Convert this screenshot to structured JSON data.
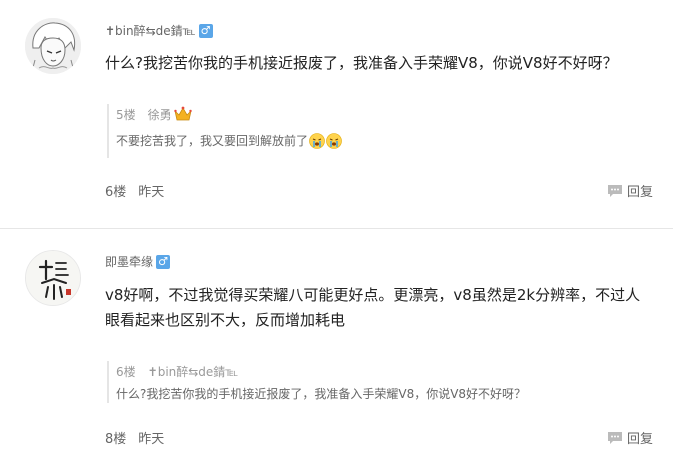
{
  "comments": [
    {
      "username": "✝bin醉⇆de錆℡",
      "gender_icon": "male-icon",
      "gender_symbol": "♂",
      "text": "什么?我挖苦你我的手机接近报废了，我准备入手荣耀V8，你说V8好不好呀？",
      "quote": {
        "floor": "5楼",
        "username": "徐勇",
        "text": "不要挖苦我了，我又要回到解放前了"
      },
      "floor": "6楼",
      "time": "昨天",
      "reply_label": "回复"
    },
    {
      "username": "即墨牵缘",
      "gender_icon": "male-icon",
      "gender_symbol": "♂",
      "text": "v8好啊，不过我觉得买荣耀八可能更好点。更漂亮，v8虽然是2k分辨率，不过人眼看起来也区别不大，反而增加耗电",
      "quote": {
        "floor": "6楼",
        "username": "✝bin醉⇆de錆℡",
        "text": "什么?我挖苦你我的手机接近报废了，我准备入手荣耀V8，你说V8好不好呀？"
      },
      "floor": "8楼",
      "time": "昨天",
      "reply_label": "回复"
    }
  ],
  "colors": {
    "badge_blue": "#5aa6e8",
    "divider": "#e6e6e6"
  }
}
